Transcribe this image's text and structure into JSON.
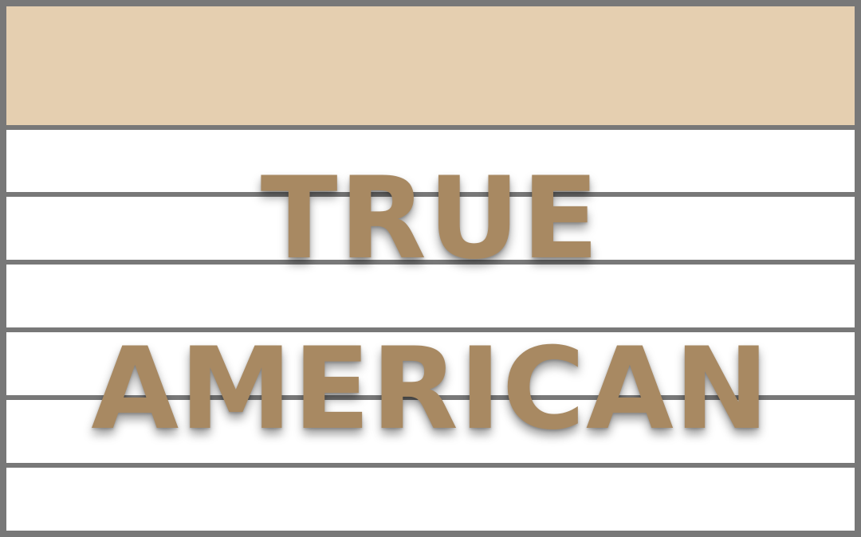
{
  "colors": {
    "frame": "#787878",
    "header_band": "#e5cfb0",
    "text": "#a88962",
    "background": "#ffffff"
  },
  "title": {
    "line1": "TRUE",
    "line2": "AMERICAN"
  }
}
